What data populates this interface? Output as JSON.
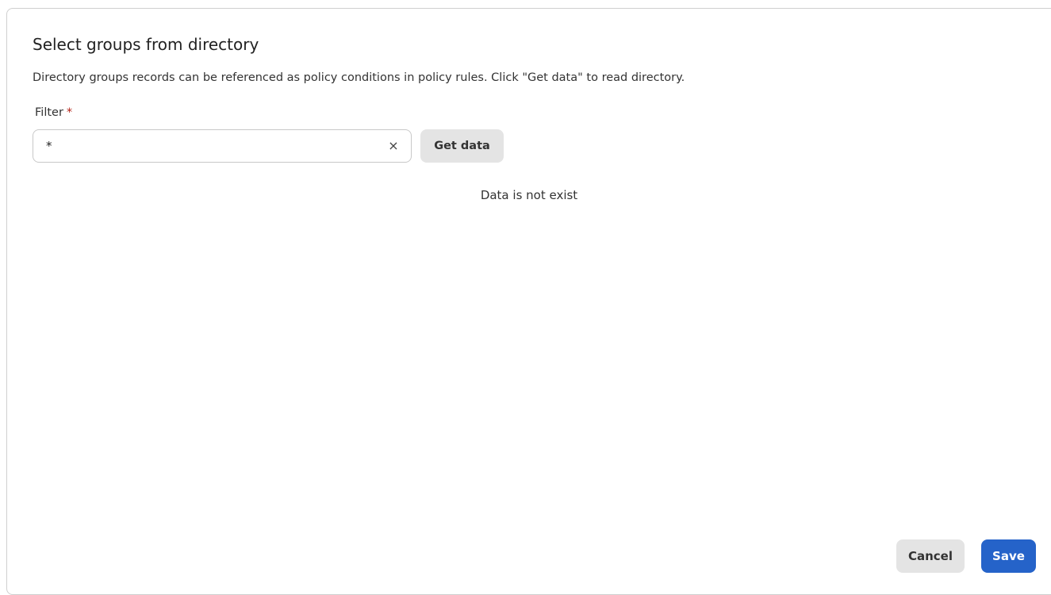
{
  "dialog": {
    "title": "Select groups from directory",
    "description": "Directory groups records can be referenced as policy conditions in policy rules. Click \"Get data\" to read directory."
  },
  "filter": {
    "label": "Filter",
    "required_mark": "*",
    "value": "*",
    "clear_icon": "×",
    "get_data_label": "Get data"
  },
  "results": {
    "empty_message": "Data is not exist"
  },
  "footer": {
    "cancel_label": "Cancel",
    "save_label": "Save"
  },
  "colors": {
    "primary": "#2563c9",
    "required": "#b42318",
    "secondary_button": "#e4e4e4"
  },
  "icons": {
    "clear": "close-icon"
  }
}
